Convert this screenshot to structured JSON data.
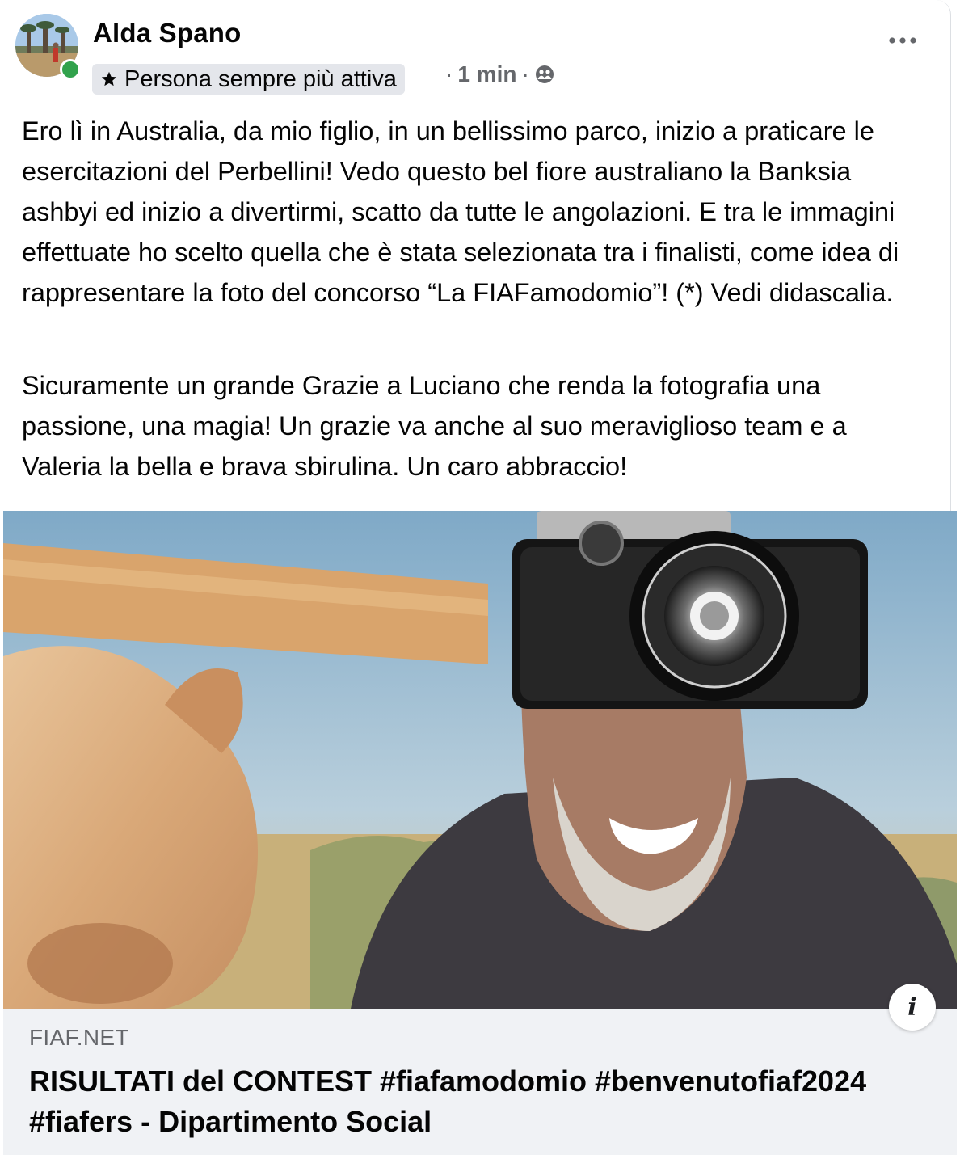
{
  "post": {
    "author": "Alda Spano",
    "badge": "Persona sempre più attiva",
    "time": "1 min",
    "separator": "·",
    "audience_icon": "friends-icon",
    "paragraphs": [
      "Ero lì in Australia, da mio figlio, in un bellissimo parco, inizio a praticare le esercitazioni del Perbellini! Vedo questo bel fiore australiano la Banksia ashbyi ed inizio a divertirmi, scatto da tutte le angolazioni. E tra le immagini effettuate ho scelto quella che è stata selezionata tra i finalisti, come idea di rappresentare la foto del concorso “La FIAFamodomio”! (*) Vedi didascalia.",
      "Sicuramente un grande Grazie a Luciano che renda la fotografia una passione, una magia! Un grazie va anche al suo meraviglioso team e a Valeria la bella e brava sbirulina. Un caro abbraccio!"
    ]
  },
  "link": {
    "domain": "FIAF.NET",
    "title": "RISULTATI del CONTEST #fiafamodomio #benvenutofiaf2024 #fiafers - Dipartimento Social",
    "info_glyph": "i"
  },
  "icons": {
    "star": "star-icon",
    "more": "more-options-icon",
    "info": "info-icon"
  },
  "colors": {
    "online": "#31a24c",
    "secondary_text": "#65676b",
    "link_bg": "#f0f2f5"
  }
}
